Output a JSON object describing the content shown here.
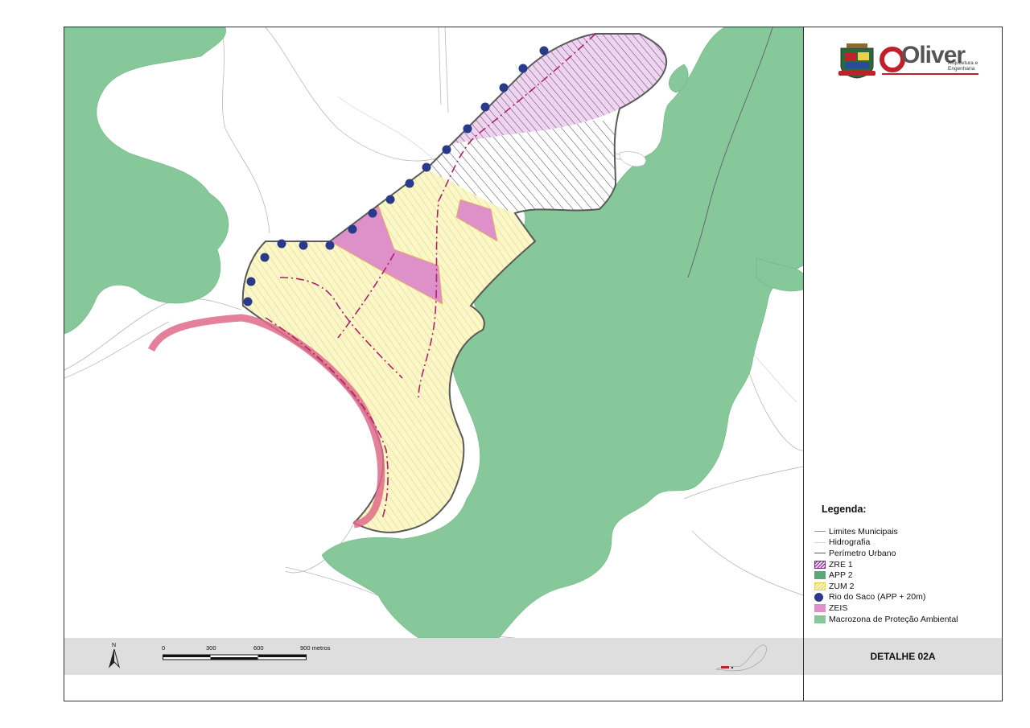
{
  "sheet": {
    "title": "DETALHE 02A"
  },
  "brand": {
    "name": "Oliver",
    "subtitle_line1": "Arquitetura e",
    "subtitle_line2": "Engenharia",
    "accent_color": "#c0202a"
  },
  "legend": {
    "title": "Legenda:",
    "items": [
      {
        "label": "Limites Municipais",
        "symbol": "line",
        "color": "#9a8fa0"
      },
      {
        "label": "Hidrografia",
        "symbol": "line",
        "color": "#c9d8e0"
      },
      {
        "label": "Perímetro Urbano",
        "symbol": "line",
        "color": "#5a5a5a"
      },
      {
        "label": "ZRE 1",
        "symbol": "hatch",
        "color": "#7a2a80"
      },
      {
        "label": "APP 2",
        "symbol": "fill",
        "color": "#5fa57a"
      },
      {
        "label": "ZUM 2",
        "symbol": "hatch-yellow",
        "color": "#e8d24a"
      },
      {
        "label": "Rio do Saco (APP + 20m)",
        "symbol": "dot",
        "color": "#2a3a8a"
      },
      {
        "label": "ZEIS",
        "symbol": "fill",
        "color": "#de90c8"
      },
      {
        "label": "Macrozona de Proteção Ambiental",
        "symbol": "fill",
        "color": "#86c89a"
      }
    ]
  },
  "scale": {
    "ticks": [
      "0",
      "300",
      "600",
      "900 metros"
    ]
  },
  "north_label": "N",
  "colors": {
    "green": "#86c89a",
    "zeis": "#de90c8",
    "zum": "#fbf7cc",
    "zre_purple": "#7a2a80",
    "perimeter": "#5a5a5a",
    "dot": "#2a3a8a",
    "road_pink": "#e06a8a"
  }
}
